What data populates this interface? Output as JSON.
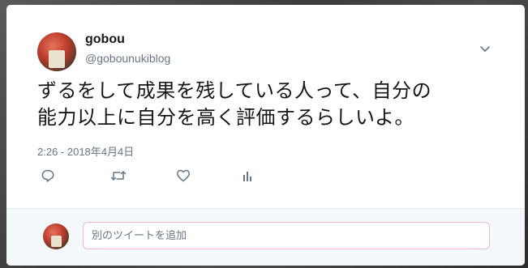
{
  "tweet": {
    "display_name": "gobou",
    "handle": "@gobounukiblog",
    "text_line1": "ずるをして成果を残している人って、自分の",
    "text_line2": "能力以上に自分を高く評価するらしいよ。",
    "timestamp": "2:26 - 2018年4月4日"
  },
  "icons": {
    "menu": "chevron-down-icon",
    "reply": "reply-icon",
    "retweet": "retweet-icon",
    "like": "heart-icon",
    "analytics": "analytics-icon"
  },
  "reply_box": {
    "placeholder": "別のツイートを追加"
  },
  "colors": {
    "primary_text": "#14171a",
    "secondary_text": "#657786",
    "reply_bg": "#f5f8fa",
    "input_border": "#f0b9c6"
  }
}
